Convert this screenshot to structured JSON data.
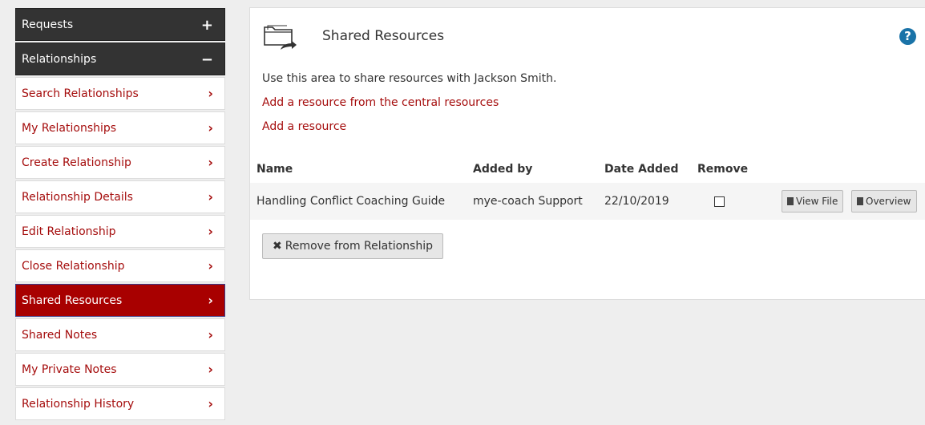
{
  "sidebar": {
    "groups": [
      {
        "label": "Requests",
        "sign": "+"
      },
      {
        "label": "Relationships",
        "sign": "−"
      }
    ],
    "items": [
      {
        "label": "Search Relationships"
      },
      {
        "label": "My Relationships"
      },
      {
        "label": "Create Relationship"
      },
      {
        "label": "Relationship Details"
      },
      {
        "label": "Edit Relationship"
      },
      {
        "label": "Close Relationship"
      },
      {
        "label": "Shared Resources"
      },
      {
        "label": "Shared Notes"
      },
      {
        "label": "My Private Notes"
      },
      {
        "label": "Relationship History"
      }
    ],
    "chevron": "›",
    "active_item": "Shared Resources"
  },
  "panel": {
    "title": "Shared Resources",
    "help": "?",
    "intro": "Use this area to share resources with Jackson Smith.",
    "link_central": "Add a resource from the central resources",
    "link_add": "Add a resource"
  },
  "table": {
    "headers": {
      "name": "Name",
      "added_by": "Added by",
      "date_added": "Date Added",
      "remove": "Remove"
    },
    "rows": [
      {
        "name": "Handling Conflict Coaching Guide",
        "added_by": "mye-coach Support",
        "date_added": "22/10/2019",
        "view_label": "View File",
        "overview_label": "Overview"
      }
    ]
  },
  "actions": {
    "remove_label": "Remove from Relationship",
    "remove_glyph": "✖"
  },
  "colors": {
    "accent": "#a50d0d",
    "active_bg": "#a80000",
    "header_bg": "#333333",
    "help": "#1a73a8"
  },
  "icons": [
    "folder-share-icon",
    "help-icon",
    "chevron-right-icon",
    "document-icon",
    "close-icon"
  ]
}
